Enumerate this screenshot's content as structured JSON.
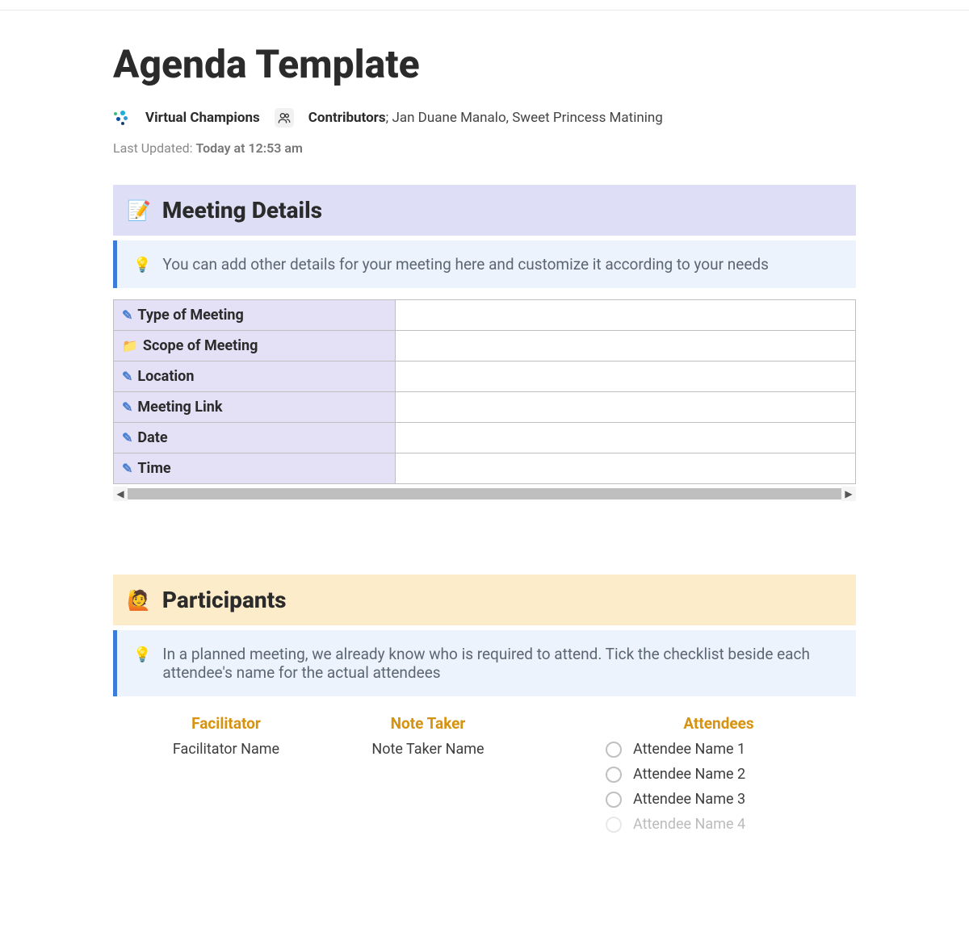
{
  "page": {
    "title": "Agenda Template",
    "team_name": "Virtual Champions",
    "contributors_label": "Contributors",
    "contributors_names": "Jan Duane Manalo, Sweet Princess Matining",
    "last_updated_label": "Last Updated:",
    "last_updated_value": "Today at 12:53 am"
  },
  "meeting_details": {
    "heading": "Meeting Details",
    "callout": "You can add other details for your meeting here and customize it according to your needs",
    "rows": [
      {
        "icon": "pencil",
        "label": "Type of Meeting",
        "value": ""
      },
      {
        "icon": "folder",
        "label": "Scope of Meeting",
        "value": ""
      },
      {
        "icon": "pencil",
        "label": "Location",
        "value": ""
      },
      {
        "icon": "pencil",
        "label": "Meeting Link",
        "value": ""
      },
      {
        "icon": "pencil",
        "label": "Date",
        "value": ""
      },
      {
        "icon": "pencil",
        "label": "Time",
        "value": ""
      }
    ]
  },
  "participants": {
    "heading": "Participants",
    "callout": "In a planned meeting, we already know who is required to attend. Tick the checklist beside each attendee's name for the actual attendees",
    "facilitator_label": "Facilitator",
    "facilitator_name": "Facilitator Name",
    "notetaker_label": "Note Taker",
    "notetaker_name": "Note Taker Name",
    "attendees_label": "Attendees",
    "attendees": [
      "Attendee Name 1",
      "Attendee Name 2",
      "Attendee Name 3",
      "Attendee Name 4"
    ]
  }
}
